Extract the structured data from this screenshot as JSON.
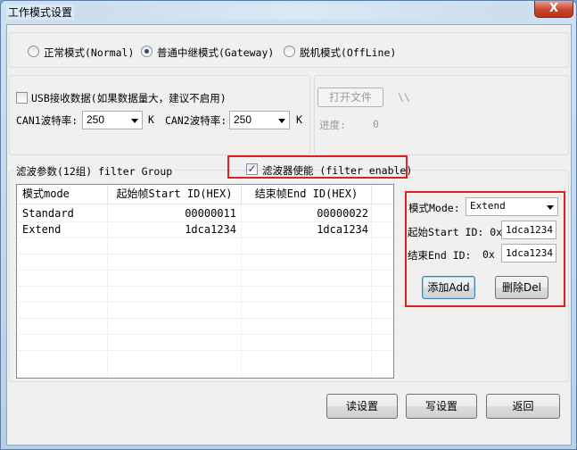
{
  "window": {
    "title": "工作模式设置",
    "close_glyph": "X"
  },
  "mode": {
    "options": [
      {
        "label": "正常模式(Normal)",
        "selected": false
      },
      {
        "label": "普通中继模式(Gateway)",
        "selected": true
      },
      {
        "label": "脱机模式(OffLine)",
        "selected": false
      }
    ]
  },
  "usb": {
    "checkbox_label": "USB接收数据(如果数据量大，建议不启用)",
    "checked": false,
    "can1_label": "CAN1波特率:",
    "can1_value": "250",
    "can2_label": "CAN2波特率:",
    "can2_value": "250",
    "unit": "K"
  },
  "file": {
    "open_button": "打开文件",
    "path": "\\\\",
    "progress_label": "进度:",
    "progress_value": "0"
  },
  "filter": {
    "group_label": "滤波参数(12组) filter Group",
    "enable_label": "滤波器使能 (filter enable)",
    "enabled": true,
    "columns": [
      "模式mode",
      "起始帧Start ID(HEX)",
      "结束帧End ID(HEX)"
    ],
    "rows": [
      {
        "mode": "Standard",
        "start": "00000011",
        "end": "00000022"
      },
      {
        "mode": "Extend",
        "start": "1dca1234",
        "end": "1dca1234"
      }
    ]
  },
  "editor": {
    "mode_label": "模式Mode:",
    "mode_value": "Extend",
    "start_label": "起始Start ID: 0x",
    "start_value": "1dca1234",
    "end_label": "结束End ID:",
    "end_prefix": "0x",
    "end_value": "1dca1234",
    "add_button": "添加Add",
    "delete_button": "删除Del"
  },
  "footer": {
    "read_button": "读设置",
    "write_button": "写设置",
    "back_button": "返回"
  },
  "colors": {
    "highlight_border": "#e02020",
    "title_bar": "#b9cfe6"
  }
}
